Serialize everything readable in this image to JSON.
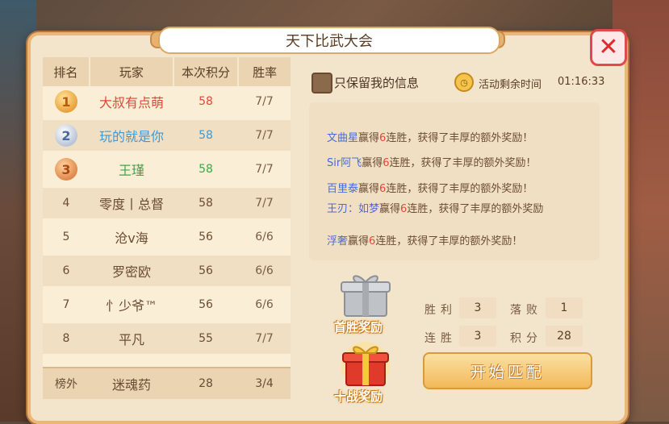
{
  "title": "天下比武大会",
  "colors": {
    "accent": "#e9b879",
    "panel": "#f3e4cc",
    "close": "#e04a4a"
  },
  "close_icon": "close-icon",
  "ranking": {
    "headers": [
      "排名",
      "玩家",
      "本次积分",
      "胜率"
    ],
    "rows": [
      {
        "rank": "1",
        "name": "大叔有点萌",
        "score": "58",
        "rate": "7/7"
      },
      {
        "rank": "2",
        "name": "玩的就是你",
        "score": "58",
        "rate": "7/7"
      },
      {
        "rank": "3",
        "name": "王瑾",
        "score": "58",
        "rate": "7/7"
      },
      {
        "rank": "4",
        "name": "零度丨总督",
        "score": "58",
        "rate": "7/7"
      },
      {
        "rank": "5",
        "name": "沧v海",
        "score": "56",
        "rate": "6/6"
      },
      {
        "rank": "6",
        "name": "罗密欧",
        "score": "56",
        "rate": "6/6"
      },
      {
        "rank": "7",
        "name": "忄少爷™",
        "score": "56",
        "rate": "6/6"
      },
      {
        "rank": "8",
        "name": "平凡",
        "score": "55",
        "rate": "7/7"
      }
    ],
    "self": {
      "rank": "榜外",
      "name": "迷魂药",
      "score": "28",
      "rate": "3/4"
    }
  },
  "filter_label": "只保留我的信息",
  "timer": {
    "label": "活动剩余时间",
    "value": "01:16:33"
  },
  "news": [
    {
      "name": "文曲星",
      "num": "6",
      "a": "赢得",
      "b": "连胜，获得了丰厚的额外奖励！"
    },
    {
      "name": "Sir阿飞",
      "num": "6",
      "a": "赢得",
      "b": "连胜，获得了丰厚的额外奖励！"
    },
    {
      "name": "百里泰",
      "num": "6",
      "a": "赢得",
      "b": "连胜，获得了丰厚的额外奖励！"
    },
    {
      "name": "王刃：如梦",
      "num": "6",
      "a": "赢得",
      "b": "连胜，获得了丰厚的额外奖励"
    },
    {
      "name": "浮奢",
      "num": "6",
      "a": "赢得",
      "b": "连胜，获得了丰厚的额外奖励！"
    }
  ],
  "rewards": {
    "first_win": "首胜奖励",
    "ten_battles": "十战奖励"
  },
  "stats": {
    "win_label": "胜利",
    "win": "3",
    "lose_label": "落败",
    "lose": "1",
    "streak_label": "连胜",
    "streak": "3",
    "points_label": "积分",
    "points": "28"
  },
  "start_button": "开始匹配"
}
